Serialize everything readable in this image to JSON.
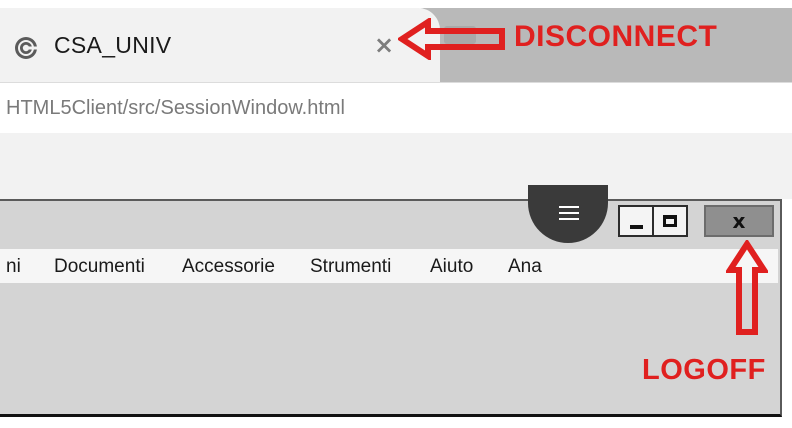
{
  "browser": {
    "tab": {
      "title": "CSA_UNIV",
      "icon": "app-logo-icon",
      "close_icon": "close-icon",
      "close_glyph": "×"
    },
    "address": {
      "url": "HTML5Client/src/SessionWindow.html"
    }
  },
  "annotations": {
    "disconnect_label": "DISCONNECT",
    "logoff_label": "LOGOFF",
    "color": "#e0201f"
  },
  "session_window": {
    "menu_icon": "hamburger-menu-icon",
    "controls": {
      "minimize_icon": "minimize-icon",
      "maximize_icon": "maximize-icon",
      "close_icon": "close-icon",
      "close_glyph": "x"
    },
    "menu": {
      "items": [
        {
          "label": "ni"
        },
        {
          "label": "Documenti"
        },
        {
          "label": "Accessorie"
        },
        {
          "label": "Strumenti"
        },
        {
          "label": "Aiuto"
        },
        {
          "label": "Ana"
        }
      ]
    }
  }
}
